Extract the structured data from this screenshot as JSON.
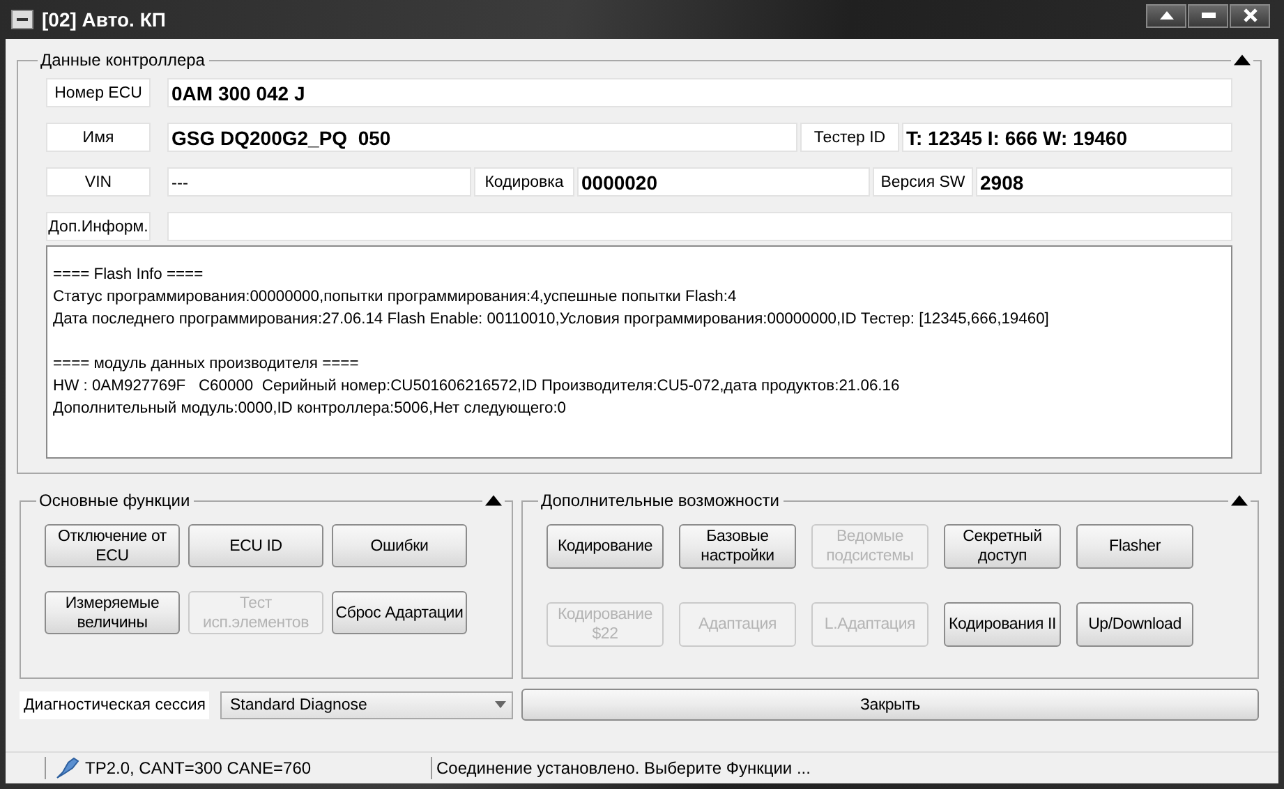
{
  "window": {
    "title": "[02] Авто. КП"
  },
  "controller_data": {
    "title": "Данные контроллера",
    "rows": [
      {
        "fields": [
          {
            "label": "Номер ECU",
            "value": "0AM 300 042 J",
            "bold": true
          }
        ]
      },
      {
        "fields": [
          {
            "label": "Имя",
            "value": "GSG DQ200G2_PQ  050",
            "bold": true
          },
          {
            "label": "Тестер ID",
            "value": "T: 12345 I: 666 W: 19460",
            "bold": true
          }
        ]
      },
      {
        "fields": [
          {
            "label": "VIN",
            "value": "---",
            "bold": false
          },
          {
            "label": "Кодировка",
            "value": "0000020",
            "bold": true
          },
          {
            "label": "Версия SW",
            "value": "2908",
            "bold": true
          }
        ]
      },
      {
        "fields": [
          {
            "label": "Доп.Информ."
          }
        ]
      }
    ],
    "info_blocks": [
      [
        "==== Flash Info ====",
        "Статус программирования:00000000,попытки программирования:4,успешные попытки Flash:4",
        "Дата последнего программирования:27.06.14 Flash Enable: 00110010,Условия программирования:00000000,ID Тестер: [12345,666,19460]"
      ],
      [
        "==== модуль данных производителя ====",
        "HW : 0AM927769F   C60000  Серийный номер:CU501606216572,ID Производителя:CU5-072,дата продуктов:21.06.16",
        "Дополнительный модуль:0000,ID контроллера:5006,Нет следующего:0"
      ]
    ]
  },
  "main_functions": {
    "title": "Основные функции",
    "buttons": [
      [
        {
          "label": "Отключение от ECU",
          "disabled": false
        },
        {
          "label": "ECU ID",
          "disabled": false
        },
        {
          "label": "Ошибки",
          "disabled": false
        }
      ],
      [
        {
          "label": "Измеряемые величины",
          "disabled": false
        },
        {
          "label": "Тест исп.элементов",
          "disabled": true
        },
        {
          "label": "Сброс Адартации",
          "disabled": false
        }
      ]
    ]
  },
  "extra_functions": {
    "title": "Дополнительные возможности",
    "buttons": [
      [
        {
          "label": "Кодирование",
          "disabled": false
        },
        {
          "label": "Базовые настройки",
          "disabled": false
        },
        {
          "label": "Ведомые подсистемы",
          "disabled": true
        },
        {
          "label": "Секретный доступ",
          "disabled": false
        },
        {
          "label": "Flasher",
          "disabled": false
        }
      ],
      [
        {
          "label": "Кодирование $22",
          "disabled": true
        },
        {
          "label": "Адаптация",
          "disabled": true
        },
        {
          "label": "L.Адаптация",
          "disabled": true
        },
        {
          "label": "Кодирования II",
          "disabled": false
        },
        {
          "label": "Up/Download",
          "disabled": false
        }
      ]
    ]
  },
  "session": {
    "label": "Диагностическая сессия",
    "value": "Standard Diagnose"
  },
  "close_button": "Закрыть",
  "status_bar": {
    "protocol": "TP2.0, CANT=300 CANE=760",
    "message": "Соединение установлено. Выберите Функции ..."
  }
}
